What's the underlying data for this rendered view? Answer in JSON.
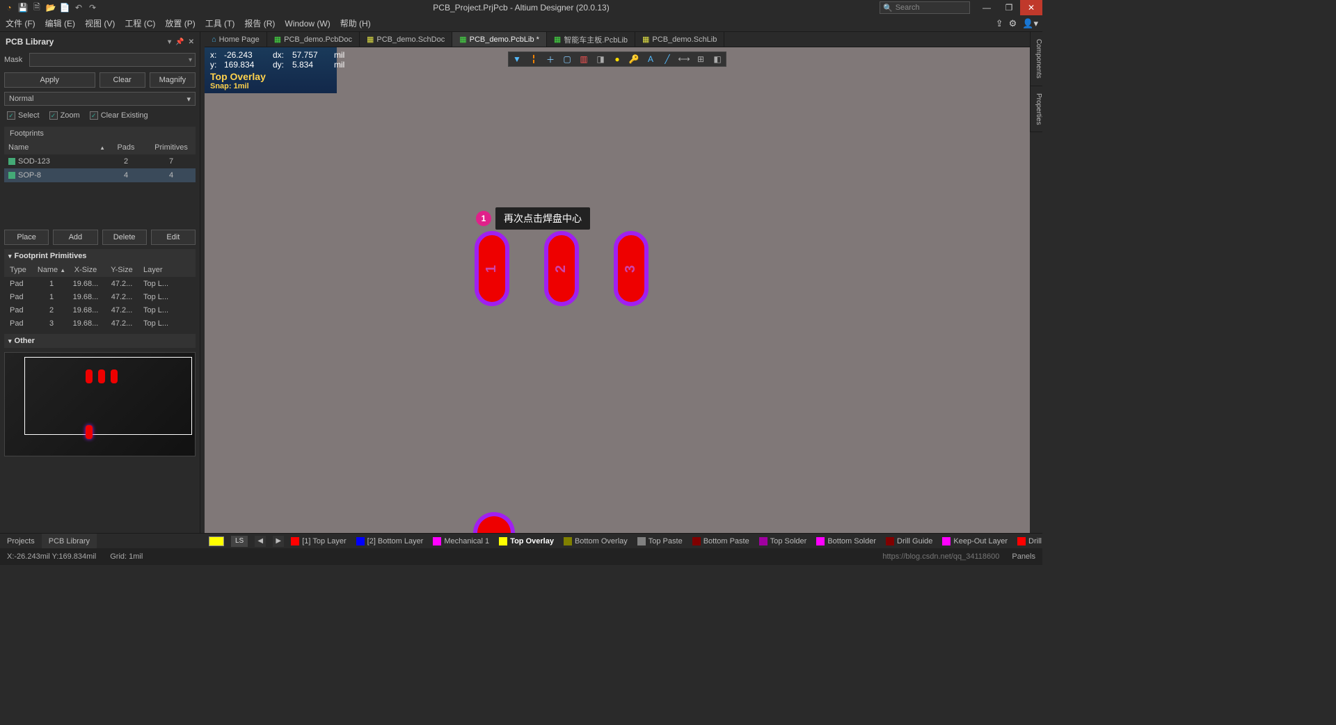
{
  "titlebar": {
    "title": "PCB_Project.PrjPcb - Altium Designer (20.0.13)",
    "search_placeholder": "Search"
  },
  "menu": [
    "文件 (F)",
    "编辑 (E)",
    "视图 (V)",
    "工程 (C)",
    "放置 (P)",
    "工具 (T)",
    "报告 (R)",
    "Window (W)",
    "帮助 (H)"
  ],
  "tabs": [
    {
      "label": "Home Page",
      "active": false,
      "icon": "home"
    },
    {
      "label": "PCB_demo.PcbDoc",
      "active": false,
      "icon": "pcb"
    },
    {
      "label": "PCB_demo.SchDoc",
      "active": false,
      "icon": "sch"
    },
    {
      "label": "PCB_demo.PcbLib *",
      "active": true,
      "icon": "pcblib"
    },
    {
      "label": "智能车主板.PcbLib",
      "active": false,
      "icon": "pcblib"
    },
    {
      "label": "PCB_demo.SchLib",
      "active": false,
      "icon": "schlib"
    }
  ],
  "sidetabs": [
    "Components",
    "Properties"
  ],
  "panel": {
    "title": "PCB Library",
    "mask_label": "Mask",
    "buttons": {
      "apply": "Apply",
      "clear": "Clear",
      "magnify": "Magnify"
    },
    "mode": "Normal",
    "checks": {
      "select": "Select",
      "zoom": "Zoom",
      "clearex": "Clear Existing"
    },
    "footprints_hdr": "Footprints",
    "fp_cols": {
      "name": "Name",
      "pads": "Pads",
      "prims": "Primitives"
    },
    "footprints": [
      {
        "name": "SOD-123",
        "pads": "2",
        "prims": "7",
        "sel": false
      },
      {
        "name": "SOP-8",
        "pads": "4",
        "prims": "4",
        "sel": true
      }
    ],
    "fp_buttons": {
      "place": "Place",
      "add": "Add",
      "del": "Delete",
      "edit": "Edit"
    },
    "prims_hdr": "Footprint Primitives",
    "prim_cols": {
      "type": "Type",
      "name": "Name",
      "xs": "X-Size",
      "ys": "Y-Size",
      "layer": "Layer"
    },
    "prims": [
      {
        "type": "Pad",
        "name": "1",
        "xs": "19.68...",
        "ys": "47.2...",
        "layer": "Top L..."
      },
      {
        "type": "Pad",
        "name": "1",
        "xs": "19.68...",
        "ys": "47.2...",
        "layer": "Top L..."
      },
      {
        "type": "Pad",
        "name": "2",
        "xs": "19.68...",
        "ys": "47.2...",
        "layer": "Top L..."
      },
      {
        "type": "Pad",
        "name": "3",
        "xs": "19.68...",
        "ys": "47.2...",
        "layer": "Top L..."
      }
    ],
    "other_hdr": "Other"
  },
  "hud": {
    "x_lbl": "x:",
    "x": " -26.243",
    "dx_lbl": "dx:",
    "dx": " 57.757",
    "unit": "mil",
    "y_lbl": "y:",
    "y": " 169.834",
    "dy_lbl": "dy:",
    "dy": "  5.834",
    "layer": "Top Overlay",
    "snap": "Snap: 1mil"
  },
  "callout": {
    "num": "1",
    "text": "再次点击焊盘中心"
  },
  "pads": [
    "1",
    "2",
    "3"
  ],
  "panel_tabs": [
    {
      "label": "Projects",
      "active": false
    },
    {
      "label": "PCB Library",
      "active": true
    }
  ],
  "layer_group": "LS",
  "layers": [
    {
      "label": "[1] Top Layer",
      "color": "#ff0000",
      "active": false
    },
    {
      "label": "[2] Bottom Layer",
      "color": "#0000ff",
      "active": false
    },
    {
      "label": "Mechanical 1",
      "color": "#ff00ff",
      "active": false
    },
    {
      "label": "Top Overlay",
      "color": "#ffff00",
      "active": true
    },
    {
      "label": "Bottom Overlay",
      "color": "#808000",
      "active": false
    },
    {
      "label": "Top Paste",
      "color": "#808080",
      "active": false
    },
    {
      "label": "Bottom Paste",
      "color": "#800000",
      "active": false
    },
    {
      "label": "Top Solder",
      "color": "#a000a0",
      "active": false
    },
    {
      "label": "Bottom Solder",
      "color": "#ff00ff",
      "active": false
    },
    {
      "label": "Drill Guide",
      "color": "#800000",
      "active": false
    },
    {
      "label": "Keep-Out Layer",
      "color": "#ff00ff",
      "active": false
    },
    {
      "label": "Drill",
      "color": "#ff0000",
      "active": false
    }
  ],
  "status": {
    "coords": "X:-26.243mil Y:169.834mil",
    "grid": "Grid: 1mil",
    "watermark": "https://blog.csdn.net/qq_34118600",
    "panels": "Panels"
  }
}
